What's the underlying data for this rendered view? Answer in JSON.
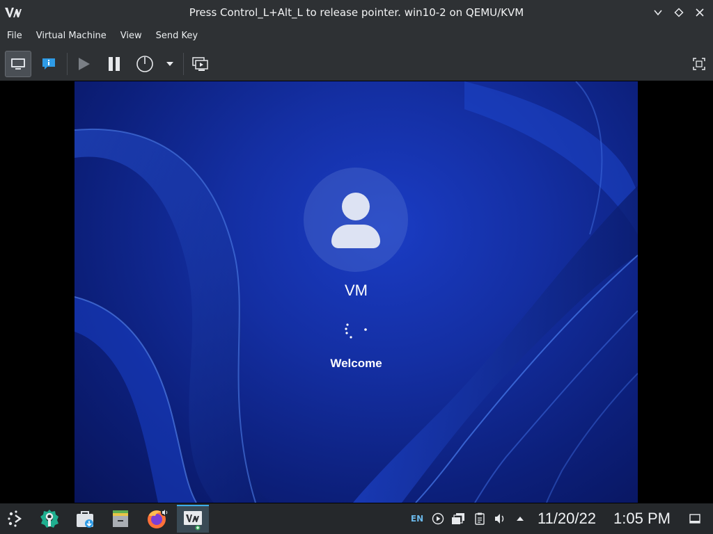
{
  "window": {
    "title": "Press Control_L+Alt_L to release pointer. win10-2 on QEMU/KVM",
    "app_logo_icon": "virt-manager-logo-icon",
    "controls": [
      "minimize-icon",
      "maximize-icon",
      "close-icon"
    ]
  },
  "menubar": {
    "items": [
      {
        "label": "File"
      },
      {
        "label": "Virtual Machine"
      },
      {
        "label": "View"
      },
      {
        "label": "Send Key"
      }
    ]
  },
  "toolbar": {
    "buttons": [
      {
        "name": "show-console-button",
        "icon": "monitor-icon",
        "active": true
      },
      {
        "name": "show-details-button",
        "icon": "info-icon",
        "active": false
      },
      {
        "name": "run-button",
        "icon": "play-icon",
        "active": false
      },
      {
        "name": "pause-button",
        "icon": "pause-icon",
        "active": false
      },
      {
        "name": "shutdown-button",
        "icon": "power-icon",
        "active": false
      },
      {
        "name": "shutdown-menu-button",
        "icon": "chevron-down-icon",
        "active": false
      },
      {
        "name": "snapshots-button",
        "icon": "snapshots-icon",
        "active": false
      },
      {
        "name": "fullscreen-button",
        "icon": "fullscreen-icon",
        "active": false
      }
    ]
  },
  "vm_screen": {
    "user_name": "VM",
    "status_text": "Welcome",
    "colors": {
      "background": "#142fa3",
      "text": "#ffffff"
    }
  },
  "taskbar": {
    "launchers": [
      {
        "name": "app-launcher-icon"
      },
      {
        "name": "system-settings-icon"
      },
      {
        "name": "discover-store-icon"
      },
      {
        "name": "file-manager-icon"
      },
      {
        "name": "firefox-icon"
      },
      {
        "name": "virt-manager-task-icon",
        "active": true
      }
    ],
    "tray": {
      "language": "EN",
      "icons": [
        "media-player-icon",
        "clipboard-icon",
        "notes-icon",
        "volume-icon",
        "tray-expand-icon"
      ],
      "date": "11/20/22",
      "time": "1:05 PM",
      "show_desktop_icon": "show-desktop-icon"
    }
  },
  "colors": {
    "accent": "#3daee9",
    "chrome": "#2e3134",
    "taskbar": "#25282b"
  }
}
